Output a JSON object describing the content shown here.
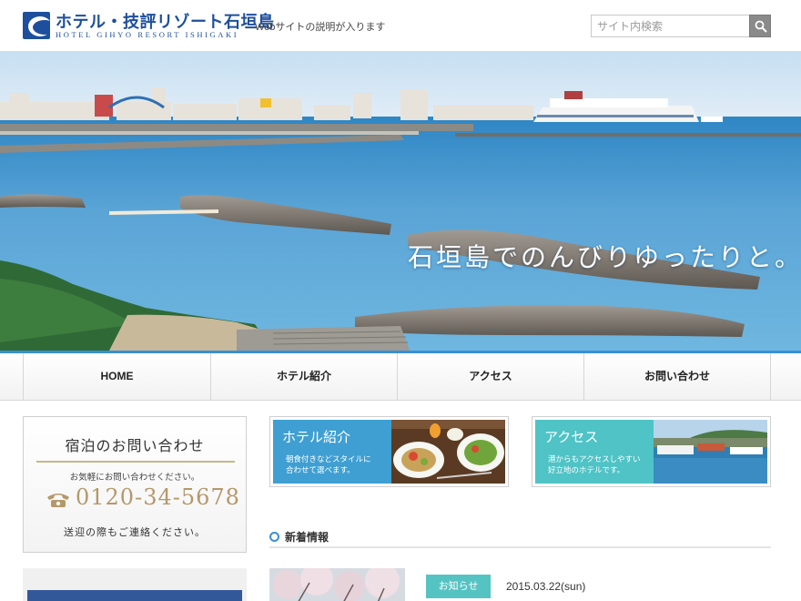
{
  "header": {
    "logo_title": "ホテル・技評リゾート石垣島",
    "logo_subtitle": "HOTEL GIHYO RESORT ISHIGAKI",
    "tagline": "Webサイトの説明が入ります",
    "search_placeholder": "サイト内検索"
  },
  "hero": {
    "caption": "石垣島でのんびりゆったりと。"
  },
  "nav": {
    "items": [
      {
        "label": "HOME"
      },
      {
        "label": "ホテル紹介"
      },
      {
        "label": "アクセス"
      },
      {
        "label": "お問い合わせ"
      }
    ]
  },
  "contact": {
    "title": "宿泊のお問い合わせ",
    "note": "お気軽にお問い合わせください。",
    "phone": "0120-34-5678",
    "footer": "送迎の際もご連絡ください。"
  },
  "cards": [
    {
      "title": "ホテル紹介",
      "desc_line1": "朝食付きなどスタイルに",
      "desc_line2": "合わせて選べます。",
      "color": "#3f9fd2"
    },
    {
      "title": "アクセス",
      "desc_line1": "港からもアクセスしやすい",
      "desc_line2": "好立地のホテルです。",
      "color": "#4fc3c6"
    }
  ],
  "news": {
    "heading": "新着情報",
    "items": [
      {
        "category": "お知らせ",
        "date": "2015.03.22(sun)"
      }
    ]
  },
  "colors": {
    "brand": "#1d4f9c",
    "accent": "#3a8fd6",
    "gold": "#b5986a",
    "teal": "#56c3c3"
  }
}
